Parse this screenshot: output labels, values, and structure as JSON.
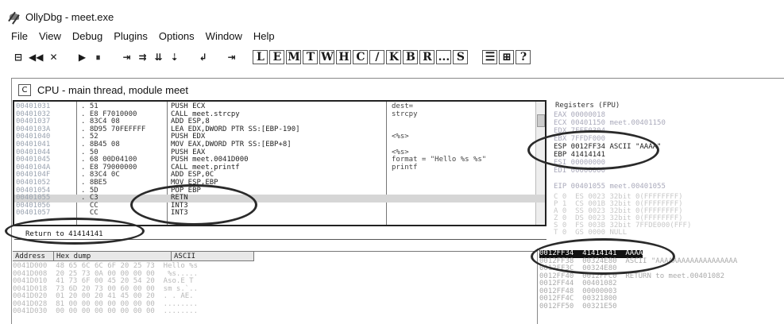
{
  "window": {
    "title": "OllyDbg - meet.exe"
  },
  "menu": [
    "File",
    "View",
    "Debug",
    "Plugins",
    "Options",
    "Window",
    "Help"
  ],
  "toolbar": {
    "groups": [
      [
        "⊟",
        "◀◀",
        "✕"
      ],
      [
        "▶",
        "⏸"
      ],
      [
        "⇥",
        "⇉",
        "⇊",
        "⇣"
      ],
      [
        "↲"
      ],
      [
        "⇥"
      ]
    ],
    "letters": [
      "L",
      "E",
      "M",
      "T",
      "W",
      "H",
      "C",
      "/",
      "K",
      "B",
      "R",
      "...",
      "S"
    ],
    "right": [
      "☰",
      "⊞",
      "?"
    ]
  },
  "cpu": {
    "title": "CPU - main thread, module meet",
    "icon": "C",
    "disasm": [
      {
        "addr": "00401031",
        "hex": ". 51",
        "asm": "PUSH ECX",
        "cmt": "dest="
      },
      {
        "addr": "00401032",
        "hex": ". E8 F7010000",
        "asm": "CALL meet.strcpy",
        "cmt": "strcpy"
      },
      {
        "addr": "00401037",
        "hex": ". 83C4 08",
        "asm": "ADD ESP,8",
        "cmt": ""
      },
      {
        "addr": "0040103A",
        "hex": ". 8D95 70FEFFFF",
        "asm": "LEA EDX,DWORD PTR SS:[EBP-190]",
        "cmt": ""
      },
      {
        "addr": "00401040",
        "hex": ". 52",
        "asm": "PUSH EDX",
        "cmt": "<%s>"
      },
      {
        "addr": "00401041",
        "hex": ". 8B45 08",
        "asm": "MOV EAX,DWORD PTR SS:[EBP+8]",
        "cmt": ""
      },
      {
        "addr": "00401044",
        "hex": ". 50",
        "asm": "PUSH EAX",
        "cmt": "<%s>"
      },
      {
        "addr": "00401045",
        "hex": ". 68 00D04100",
        "asm": "PUSH meet.0041D000",
        "cmt": "format = \"Hello %s %s\""
      },
      {
        "addr": "0040104A",
        "hex": ". E8 79000000",
        "asm": "CALL meet.printf",
        "cmt": "printf"
      },
      {
        "addr": "0040104F",
        "hex": ". 83C4 0C",
        "asm": "ADD ESP,0C",
        "cmt": ""
      },
      {
        "addr": "00401052",
        "hex": ". 8BE5",
        "asm": "MOV ESP,EBP",
        "cmt": ""
      },
      {
        "addr": "00401054",
        "hex": ". 5D",
        "asm": "POP EBP",
        "cmt": ""
      },
      {
        "addr": "00401055",
        "hex": ". C3",
        "asm": "RETN",
        "cmt": ""
      },
      {
        "addr": "00401056",
        "hex": "  CC",
        "asm": "INT3",
        "cmt": ""
      },
      {
        "addr": "00401057",
        "hex": "  CC",
        "asm": "INT3",
        "cmt": ""
      }
    ],
    "info": "Return to 41414141"
  },
  "registers": {
    "header": "Registers (FPU)",
    "rows": [
      {
        "text": "EAX 00000018",
        "dark": false
      },
      {
        "text": "ECX 00401150 meet.00401150",
        "dark": false
      },
      {
        "text": "EDX 7FFE0304",
        "dark": false
      },
      {
        "text": "EBX 7FFDF000",
        "dark": false
      },
      {
        "text": "ESP 0012FF34 ASCII \"AAAA\"",
        "dark": true
      },
      {
        "text": "EBP 41414141",
        "dark": true
      },
      {
        "text": "ESI 00000000",
        "dark": false
      },
      {
        "text": "EDI 00000000",
        "dark": false
      },
      {
        "text": "",
        "dark": false
      },
      {
        "text": "EIP 00401055 meet.00401055",
        "dark": false
      }
    ],
    "flags": "C 0  ES 0023 32bit 0(FFFFFFFF)\nP 1  CS 001B 32bit 0(FFFFFFFF)\nA 0  SS 0023 32bit 0(FFFFFFFF)\nZ 0  DS 0023 32bit 0(FFFFFFFF)\nS 0  FS 003B 32bit 7FFDE000(FFF)\nT 0  GS 0000 NULL"
  },
  "dump": {
    "headers": [
      "Address",
      "Hex dump",
      "ASCII"
    ],
    "rows": [
      "0041D000  48 65 6C 6C 6F 20 25 73  Hello %s",
      "0041D008  20 25 73 0A 00 00 00 00   %s.....",
      "0041D010  41 73 6F 00 45 20 54 20  Aso.E T ",
      "0041D018  73 6D 20 73 00 60 00 00  sm s.`..",
      "0041D020  01 20 00 20 41 45 00 20  . . AE. ",
      "0041D028  81 00 00 00 00 00 00 00  ........",
      "0041D030  00 00 00 00 00 00 00 00  ........"
    ]
  },
  "stack": {
    "rows": [
      {
        "text": "0012FF34  41414141  AAAA",
        "sel": true
      },
      {
        "text": "0012FF38  00324E80  ASCII \"AAAAAAAAAAAAAAAAAAA",
        "sel": false
      },
      {
        "text": "0012FF3C  00324E80",
        "sel": false
      },
      {
        "text": "0012FF40  0012FFC0  RETURN to meet.00401082",
        "sel": false
      },
      {
        "text": "0012FF44  00401082",
        "sel": false
      },
      {
        "text": "0012FF48  00000003",
        "sel": false
      },
      {
        "text": "0012FF4C  00321800",
        "sel": false
      },
      {
        "text": "0012FF50  00321E50",
        "sel": false
      }
    ]
  }
}
